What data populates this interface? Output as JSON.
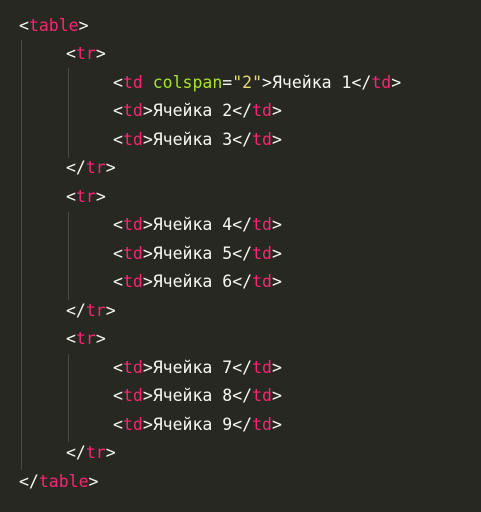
{
  "code": {
    "table_tag": "table",
    "tr_tag": "tr",
    "td_tag": "td",
    "colspan_attr": "colspan",
    "colspan_value": "\"2\"",
    "cells": [
      "Ячейка 1",
      "Ячейка 2",
      "Ячейка 3",
      "Ячейка 4",
      "Ячейка 5",
      "Ячейка 6",
      "Ячейка 7",
      "Ячейка 8",
      "Ячейка 9"
    ]
  },
  "colors": {
    "background": "#272822",
    "tag": "#F92672",
    "attribute": "#A6E22E",
    "string": "#E6DB74",
    "text": "#F8F8F2",
    "indent_guide": "#4A4B44"
  }
}
